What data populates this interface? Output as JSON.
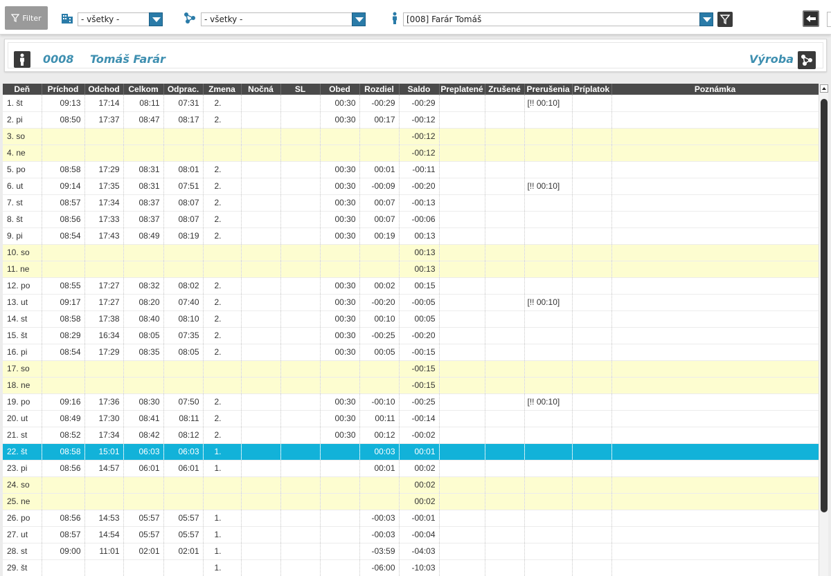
{
  "toolbar": {
    "filter_label": "Filter",
    "location_select": "- všetky -",
    "group_select": "- všetky -",
    "employee_select": "[008] Farár Tomáš"
  },
  "employee": {
    "number": "0008",
    "name": "Tomáš Farár",
    "department": "Výroba"
  },
  "columns": [
    "Deň",
    "Príchod",
    "Odchod",
    "Celkom",
    "Odprac.",
    "Zmena",
    "Nočná",
    "SL",
    "Obed",
    "Rozdiel",
    "Saldo",
    "Preplatené",
    "Zrušené",
    "Prerušenia",
    "Príplatok",
    "Poznámka"
  ],
  "rows": [
    {
      "day": "1. št",
      "in": "09:13",
      "out": "17:14",
      "total": "08:11",
      "worked": "07:31",
      "shift": "2.",
      "lunch": "00:30",
      "diff": "-00:29",
      "saldo": "-00:29",
      "breaks": "[!! 00:10]"
    },
    {
      "day": "2. pi",
      "in": "08:50",
      "out": "17:37",
      "total": "08:47",
      "worked": "08:17",
      "shift": "2.",
      "lunch": "00:30",
      "diff": "00:17",
      "saldo": "-00:12",
      "breaks": ""
    },
    {
      "day": "3. so",
      "saldo": "-00:12",
      "weekend": true
    },
    {
      "day": "4. ne",
      "saldo": "-00:12",
      "weekend": true
    },
    {
      "day": "5. po",
      "in": "08:58",
      "out": "17:29",
      "total": "08:31",
      "worked": "08:01",
      "shift": "2.",
      "lunch": "00:30",
      "diff": "00:01",
      "saldo": "-00:11",
      "breaks": ""
    },
    {
      "day": "6. ut",
      "in": "09:14",
      "out": "17:35",
      "total": "08:31",
      "worked": "07:51",
      "shift": "2.",
      "lunch": "00:30",
      "diff": "-00:09",
      "saldo": "-00:20",
      "breaks": "[!! 00:10]"
    },
    {
      "day": "7. st",
      "in": "08:57",
      "out": "17:34",
      "total": "08:37",
      "worked": "08:07",
      "shift": "2.",
      "lunch": "00:30",
      "diff": "00:07",
      "saldo": "-00:13",
      "breaks": ""
    },
    {
      "day": "8. št",
      "in": "08:56",
      "out": "17:33",
      "total": "08:37",
      "worked": "08:07",
      "shift": "2.",
      "lunch": "00:30",
      "diff": "00:07",
      "saldo": "-00:06",
      "breaks": ""
    },
    {
      "day": "9. pi",
      "in": "08:54",
      "out": "17:43",
      "total": "08:49",
      "worked": "08:19",
      "shift": "2.",
      "lunch": "00:30",
      "diff": "00:19",
      "saldo": "00:13",
      "breaks": ""
    },
    {
      "day": "10. so",
      "saldo": "00:13",
      "weekend": true
    },
    {
      "day": "11. ne",
      "saldo": "00:13",
      "weekend": true
    },
    {
      "day": "12. po",
      "in": "08:55",
      "out": "17:27",
      "total": "08:32",
      "worked": "08:02",
      "shift": "2.",
      "lunch": "00:30",
      "diff": "00:02",
      "saldo": "00:15",
      "breaks": ""
    },
    {
      "day": "13. ut",
      "in": "09:17",
      "out": "17:27",
      "total": "08:20",
      "worked": "07:40",
      "shift": "2.",
      "lunch": "00:30",
      "diff": "-00:20",
      "saldo": "-00:05",
      "breaks": "[!! 00:10]"
    },
    {
      "day": "14. st",
      "in": "08:58",
      "out": "17:38",
      "total": "08:40",
      "worked": "08:10",
      "shift": "2.",
      "lunch": "00:30",
      "diff": "00:10",
      "saldo": "00:05",
      "breaks": ""
    },
    {
      "day": "15. št",
      "in": "08:29",
      "out": "16:34",
      "total": "08:05",
      "worked": "07:35",
      "shift": "2.",
      "lunch": "00:30",
      "diff": "-00:25",
      "saldo": "-00:20",
      "breaks": ""
    },
    {
      "day": "16. pi",
      "in": "08:54",
      "out": "17:29",
      "total": "08:35",
      "worked": "08:05",
      "shift": "2.",
      "lunch": "00:30",
      "diff": "00:05",
      "saldo": "-00:15",
      "breaks": ""
    },
    {
      "day": "17. so",
      "saldo": "-00:15",
      "weekend": true
    },
    {
      "day": "18. ne",
      "saldo": "-00:15",
      "weekend": true
    },
    {
      "day": "19. po",
      "in": "09:16",
      "out": "17:36",
      "total": "08:30",
      "worked": "07:50",
      "shift": "2.",
      "lunch": "00:30",
      "diff": "-00:10",
      "saldo": "-00:25",
      "breaks": "[!! 00:10]"
    },
    {
      "day": "20. ut",
      "in": "08:49",
      "out": "17:30",
      "total": "08:41",
      "worked": "08:11",
      "shift": "2.",
      "lunch": "00:30",
      "diff": "00:11",
      "saldo": "-00:14",
      "breaks": ""
    },
    {
      "day": "21. st",
      "in": "08:52",
      "out": "17:34",
      "total": "08:42",
      "worked": "08:12",
      "shift": "2.",
      "lunch": "00:30",
      "diff": "00:12",
      "saldo": "-00:02",
      "breaks": ""
    },
    {
      "day": "22. št",
      "in": "08:58",
      "out": "15:01",
      "total": "06:03",
      "worked": "06:03",
      "shift": "1.",
      "lunch": "",
      "diff": "00:03",
      "saldo": "00:01",
      "breaks": "",
      "selected": true
    },
    {
      "day": "23. pi",
      "in": "08:56",
      "out": "14:57",
      "total": "06:01",
      "worked": "06:01",
      "shift": "1.",
      "lunch": "",
      "diff": "00:01",
      "saldo": "00:02",
      "breaks": ""
    },
    {
      "day": "24. so",
      "saldo": "00:02",
      "weekend": true
    },
    {
      "day": "25. ne",
      "saldo": "00:02",
      "weekend": true
    },
    {
      "day": "26. po",
      "in": "08:56",
      "out": "14:53",
      "total": "05:57",
      "worked": "05:57",
      "shift": "1.",
      "lunch": "",
      "diff": "-00:03",
      "saldo": "-00:01",
      "breaks": ""
    },
    {
      "day": "27. ut",
      "in": "08:57",
      "out": "14:54",
      "total": "05:57",
      "worked": "05:57",
      "shift": "1.",
      "lunch": "",
      "diff": "-00:03",
      "saldo": "-00:04",
      "breaks": ""
    },
    {
      "day": "28. st",
      "in": "09:00",
      "out": "11:01",
      "total": "02:01",
      "worked": "02:01",
      "shift": "1.",
      "lunch": "",
      "diff": "-03:59",
      "saldo": "-04:03",
      "breaks": ""
    },
    {
      "day": "29. št",
      "in": "",
      "out": "",
      "total": "",
      "worked": "",
      "shift": "1.",
      "lunch": "",
      "diff": "-06:00",
      "saldo": "-10:03",
      "breaks": ""
    }
  ]
}
